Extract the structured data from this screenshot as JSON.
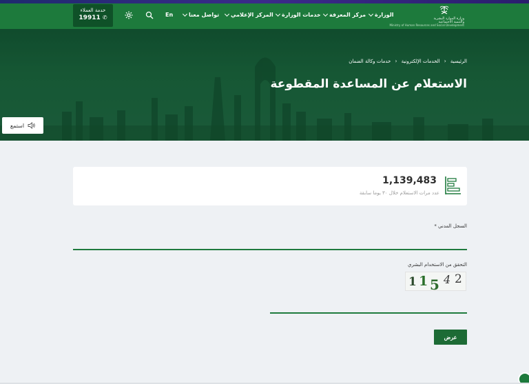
{
  "header": {
    "logo_lines": [
      "وزارة الموارد البشرية",
      "والتنمية الاجتماعية",
      "Ministry of Human Resources and Social Development"
    ],
    "nav": [
      {
        "label": "الوزارة",
        "dropdown": true
      },
      {
        "label": "مركز المعرفة",
        "dropdown": true
      },
      {
        "label": "خدمات الوزارة",
        "dropdown": true
      },
      {
        "label": "المركز الإعلامي",
        "dropdown": true
      },
      {
        "label": "تواصل معنا",
        "dropdown": true
      }
    ],
    "lang": "En",
    "customer_service": {
      "label": "خدمة العملاء",
      "phone": "19911"
    }
  },
  "hero": {
    "breadcrumbs": [
      "الرئيسية",
      "الخدمات الإلكترونية",
      "خدمات وكالة الضمان"
    ],
    "title": "الاستعلام عن المساعدة المقطوعة",
    "listen": "استمع"
  },
  "stats": {
    "value": "1,139,483",
    "label": "عدد مرات الاستعلام خلال ٣٠ يوما سابقة"
  },
  "form": {
    "civil_label": "السجل المدني *",
    "civil_value": "",
    "captcha_label": "التحقق من الاستخدام البشري",
    "captcha_chars": [
      "1",
      "1",
      "5",
      "4",
      "2"
    ],
    "captcha_value": "",
    "submit": "عرض"
  },
  "colors": {
    "primary": "#1d7a3c",
    "dark": "#0f5128",
    "hero": "#175a36"
  }
}
